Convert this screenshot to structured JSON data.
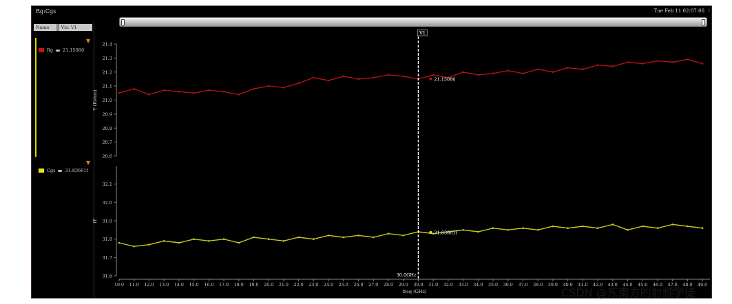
{
  "window": {
    "title": "Rg:Cgs",
    "date": "Tue Feb 11 02:07:06"
  },
  "sidebar": {
    "header_name": "Name",
    "header_vis": "Vis: V1"
  },
  "legend": [
    {
      "label": "Rg",
      "value": "21.15086",
      "color": "#c81414"
    },
    {
      "label": "Cgs",
      "value": "31.83661f",
      "color": "#e6e61e"
    }
  ],
  "marker": {
    "label": "V1",
    "x_label": "30.0GHz",
    "rg_value": "21.15086",
    "cgs_value": "31.83661f"
  },
  "watermark": "CSDN @东南方的射频学徒",
  "chart_data": [
    {
      "type": "line",
      "ylabel": "Y (Kohm)",
      "series": [
        {
          "name": "Rg",
          "color": "#b01414"
        }
      ],
      "x": [
        10.0,
        11.0,
        12.0,
        13.0,
        14.0,
        15.0,
        16.0,
        17.0,
        18.0,
        19.0,
        20.0,
        21.0,
        22.0,
        23.0,
        24.0,
        25.0,
        26.0,
        27.0,
        28.0,
        29.0,
        30.0,
        31.0,
        32.0,
        33.0,
        34.0,
        35.0,
        36.0,
        37.0,
        38.0,
        39.0,
        40.0,
        41.0,
        42.0,
        43.0,
        44.0,
        45.0,
        46.0,
        47.0,
        48.0,
        49.0
      ],
      "values": [
        21.05,
        21.08,
        21.04,
        21.07,
        21.06,
        21.05,
        21.07,
        21.06,
        21.04,
        21.08,
        21.1,
        21.09,
        21.12,
        21.16,
        21.14,
        21.17,
        21.15,
        21.16,
        21.18,
        21.17,
        21.15,
        21.18,
        21.16,
        21.2,
        21.18,
        21.19,
        21.21,
        21.19,
        21.22,
        21.2,
        21.23,
        21.22,
        21.25,
        21.24,
        21.27,
        21.26,
        21.28,
        21.27,
        21.29,
        21.26
      ],
      "ylim": [
        20.6,
        21.4
      ],
      "yticks": [
        "21.4",
        "21.3",
        "21.2",
        "21.1",
        "21.0",
        "20.9",
        "20.8",
        "20.7",
        "20.6"
      ]
    },
    {
      "type": "line",
      "ylabel": "fF",
      "series": [
        {
          "name": "Cgs",
          "color": "#c8c81e"
        }
      ],
      "x": [
        10.0,
        11.0,
        12.0,
        13.0,
        14.0,
        15.0,
        16.0,
        17.0,
        18.0,
        19.0,
        20.0,
        21.0,
        22.0,
        23.0,
        24.0,
        25.0,
        26.0,
        27.0,
        28.0,
        29.0,
        30.0,
        31.0,
        32.0,
        33.0,
        34.0,
        35.0,
        36.0,
        37.0,
        38.0,
        39.0,
        40.0,
        41.0,
        42.0,
        43.0,
        44.0,
        45.0,
        46.0,
        47.0,
        48.0,
        49.0
      ],
      "values": [
        31.78,
        31.76,
        31.77,
        31.79,
        31.78,
        31.8,
        31.79,
        31.8,
        31.78,
        31.81,
        31.8,
        31.79,
        31.81,
        31.8,
        31.82,
        31.81,
        31.82,
        31.81,
        31.83,
        31.82,
        31.84,
        31.83,
        31.84,
        31.85,
        31.84,
        31.86,
        31.85,
        31.86,
        31.85,
        31.87,
        31.86,
        31.87,
        31.86,
        31.88,
        31.85,
        31.87,
        31.86,
        31.88,
        31.87,
        31.86
      ],
      "ylim": [
        31.6,
        32.2
      ],
      "yticks": [
        "32.1",
        "32.0",
        "31.9",
        "31.8",
        "31.7",
        "31.6"
      ]
    }
  ],
  "xaxis": {
    "label": "freq (GHz)",
    "ticks": [
      "10.0",
      "11.0",
      "12.0",
      "13.0",
      "14.0",
      "15.0",
      "16.0",
      "17.0",
      "18.0",
      "19.0",
      "20.0",
      "21.0",
      "22.0",
      "23.0",
      "24.0",
      "25.0",
      "26.0",
      "27.0",
      "28.0",
      "29.0",
      "30.0",
      "31.0",
      "32.0",
      "33.0",
      "34.0",
      "35.0",
      "36.0",
      "37.0",
      "38.0",
      "39.0",
      "40.0",
      "41.0",
      "42.0",
      "43.0",
      "44.0",
      "45.0",
      "46.0",
      "47.0",
      "48.0",
      "49.0"
    ]
  }
}
